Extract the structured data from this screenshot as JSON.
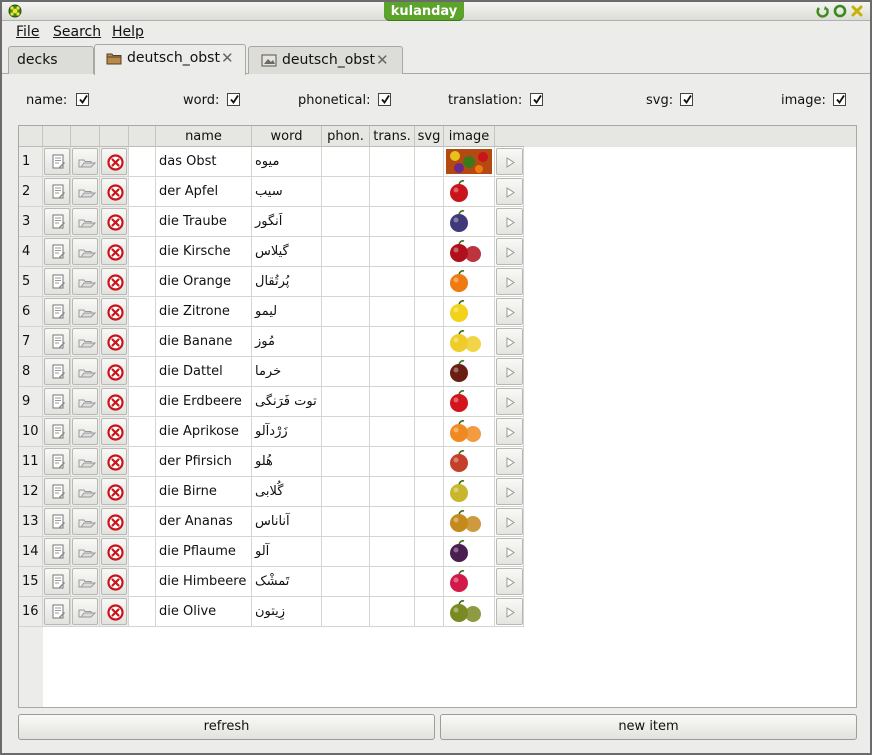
{
  "window": {
    "title": "kulanday"
  },
  "menu": [
    {
      "label": "File",
      "key": "file"
    },
    {
      "label": "Search",
      "key": "search"
    },
    {
      "label": "Help",
      "key": "help"
    }
  ],
  "tabs": [
    {
      "label": "decks",
      "icon": null,
      "closable": false,
      "active": false
    },
    {
      "label": "deutsch_obst",
      "icon": "folder-icon",
      "closable": true,
      "active": true
    },
    {
      "label": "deutsch_obst",
      "icon": "image-file-icon",
      "closable": true,
      "active": false
    }
  ],
  "filters": [
    {
      "label": "name:",
      "checked": true
    },
    {
      "label": "word:",
      "checked": true
    },
    {
      "label": "phonetical:",
      "checked": true
    },
    {
      "label": "translation:",
      "checked": true
    },
    {
      "label": "svg:",
      "checked": true
    },
    {
      "label": "image:",
      "checked": true
    }
  ],
  "table": {
    "headers": [
      "name",
      "word",
      "phon.",
      "trans.",
      "svg",
      "image"
    ],
    "rows": [
      {
        "num": "1",
        "name": "das Obst",
        "word": "میوه",
        "image": "mixed-fruit",
        "color": "#b44a12"
      },
      {
        "num": "2",
        "name": "der Apfel",
        "word": "سیب",
        "image": "apple",
        "color": "#c8141a"
      },
      {
        "num": "3",
        "name": "die Traube",
        "word": "اَنگور",
        "image": "grapes",
        "color": "#3e3a7a"
      },
      {
        "num": "4",
        "name": "die Kirsche",
        "word": "گیلاس",
        "image": "cherry",
        "color": "#b0101c"
      },
      {
        "num": "5",
        "name": "die Orange",
        "word": "پُرتُقال",
        "image": "orange",
        "color": "#f07a10"
      },
      {
        "num": "6",
        "name": "die Zitrone",
        "word": "لیمو",
        "image": "lemon",
        "color": "#f2d21a"
      },
      {
        "num": "7",
        "name": "die Banane",
        "word": "مُوز",
        "image": "banana",
        "color": "#f0cc28"
      },
      {
        "num": "8",
        "name": "die Dattel",
        "word": "خرما",
        "image": "dates",
        "color": "#6a1e12"
      },
      {
        "num": "9",
        "name": "die Erdbeere",
        "word": "توت فَرَنگی",
        "image": "strawberry",
        "color": "#d4141c"
      },
      {
        "num": "10",
        "name": "die Aprikose",
        "word": "زَرْدآلو",
        "image": "apricot",
        "color": "#f08a20"
      },
      {
        "num": "11",
        "name": "der Pfirsich",
        "word": "هُلو",
        "image": "peach",
        "color": "#c4402a"
      },
      {
        "num": "12",
        "name": "die Birne",
        "word": "گُلابی",
        "image": "pear",
        "color": "#c8b62c"
      },
      {
        "num": "13",
        "name": "der Ananas",
        "word": "آناناس",
        "image": "pineapple",
        "color": "#c48a1c"
      },
      {
        "num": "14",
        "name": "die Pflaume",
        "word": "آلو",
        "image": "plum",
        "color": "#4a1e50"
      },
      {
        "num": "15",
        "name": "die Himbeere",
        "word": "تَمشْک",
        "image": "raspberry",
        "color": "#d21a4a"
      },
      {
        "num": "16",
        "name": "die Olive",
        "word": "زِیتون",
        "image": "olive",
        "color": "#7a8a22"
      }
    ]
  },
  "buttons": {
    "refresh": "refresh",
    "new_item": "new item"
  }
}
